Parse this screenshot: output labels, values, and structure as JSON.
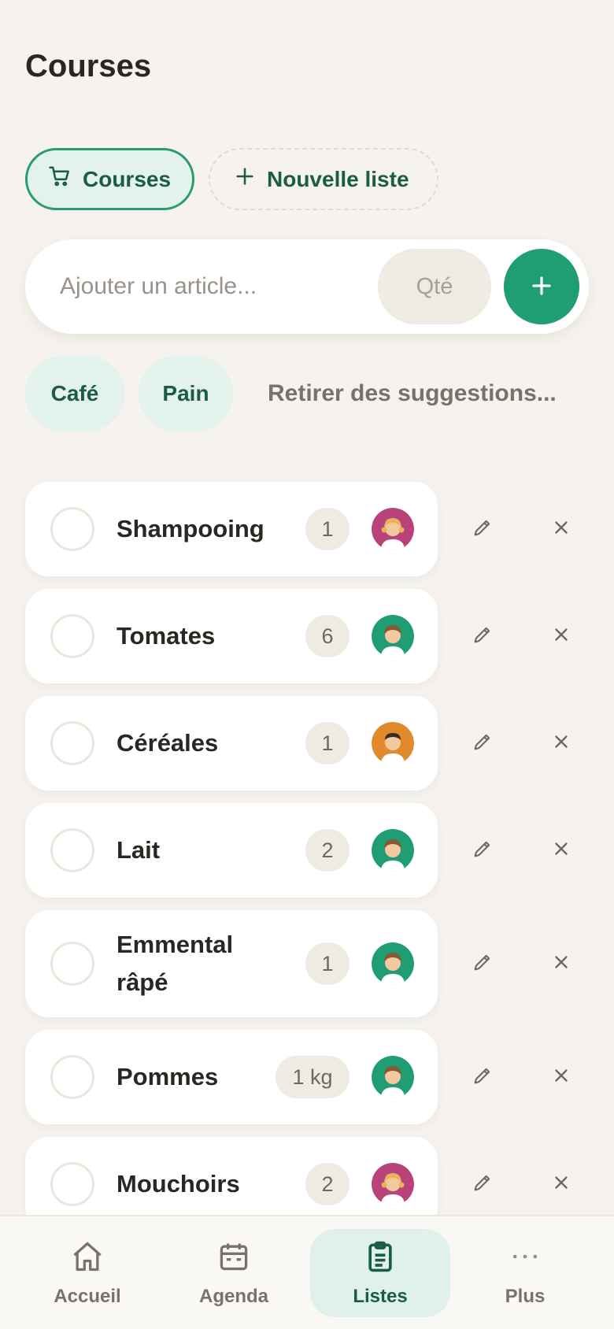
{
  "header": {
    "title": "Courses"
  },
  "tabs": [
    {
      "label": "Courses",
      "icon": "cart-icon",
      "active": true
    },
    {
      "label": "Nouvelle liste",
      "icon": "plus-icon",
      "active": false
    }
  ],
  "add_bar": {
    "item_placeholder": "Ajouter un article...",
    "qty_placeholder": "Qté",
    "add_icon": "plus-icon"
  },
  "suggestions": {
    "chips": [
      "Café",
      "Pain"
    ],
    "remove_label": "Retirer des suggestions..."
  },
  "items": [
    {
      "name": "Shampooing",
      "qty": "1",
      "assignee": "pink"
    },
    {
      "name": "Tomates",
      "qty": "6",
      "assignee": "green"
    },
    {
      "name": "Céréales",
      "qty": "1",
      "assignee": "orange"
    },
    {
      "name": "Lait",
      "qty": "2",
      "assignee": "green"
    },
    {
      "name": "Emmental râpé",
      "qty": "1",
      "assignee": "green"
    },
    {
      "name": "Pommes",
      "qty": "1 kg",
      "assignee": "green"
    },
    {
      "name": "Mouchoirs",
      "qty": "2",
      "assignee": "pink"
    }
  ],
  "bottom_nav": [
    {
      "label": "Accueil",
      "icon": "home-icon",
      "active": false
    },
    {
      "label": "Agenda",
      "icon": "calendar-icon",
      "active": false
    },
    {
      "label": "Listes",
      "icon": "clipboard-list-icon",
      "active": true
    },
    {
      "label": "Plus",
      "icon": "more-dots-icon",
      "active": false
    }
  ],
  "colors": {
    "accent": "#1f9d74",
    "accent_light": "#e3f2ec",
    "avatar_pink": "#b8437a",
    "avatar_green": "#1f9d74",
    "avatar_orange": "#e08a2c"
  }
}
